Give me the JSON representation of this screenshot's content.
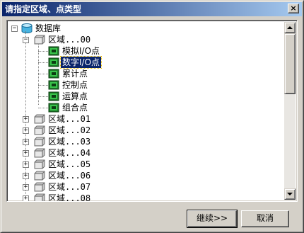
{
  "window": {
    "title": "请指定区域、点类型",
    "close_label": "×"
  },
  "tree": {
    "root": {
      "label": "数据库",
      "expander": "−",
      "icon": "database-icon"
    },
    "areas": [
      {
        "label": "区域...00",
        "expander": "−",
        "icon": "folder-icon",
        "children": [
          {
            "label": "模拟I/O点",
            "icon": "point-type-icon"
          },
          {
            "label": "数字I/O点",
            "icon": "point-type-icon",
            "selected": true
          },
          {
            "label": "累计点",
            "icon": "point-type-icon"
          },
          {
            "label": "控制点",
            "icon": "point-type-icon"
          },
          {
            "label": "运算点",
            "icon": "point-type-icon"
          },
          {
            "label": "组合点",
            "icon": "point-type-icon"
          }
        ]
      },
      {
        "label": "区域...01",
        "expander": "+",
        "icon": "folder-icon"
      },
      {
        "label": "区域...02",
        "expander": "+",
        "icon": "folder-icon"
      },
      {
        "label": "区域...03",
        "expander": "+",
        "icon": "folder-icon"
      },
      {
        "label": "区域...04",
        "expander": "+",
        "icon": "folder-icon"
      },
      {
        "label": "区域...05",
        "expander": "+",
        "icon": "folder-icon"
      },
      {
        "label": "区域...06",
        "expander": "+",
        "icon": "folder-icon"
      },
      {
        "label": "区域...07",
        "expander": "+",
        "icon": "folder-icon"
      },
      {
        "label": "区域...08",
        "expander": "+",
        "icon": "folder-icon"
      }
    ]
  },
  "buttons": {
    "continue_label": "继续>>",
    "cancel_label": "取消"
  },
  "colors": {
    "selection": "#0a246a",
    "titlebar_start": "#0a246a",
    "titlebar_end": "#a6caf0",
    "face": "#d4d0c8"
  }
}
